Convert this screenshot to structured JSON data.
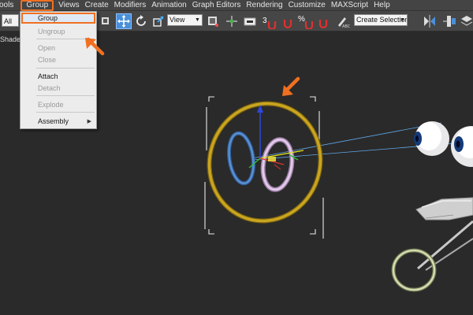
{
  "menu": {
    "items": [
      "ools",
      "Group",
      "Views",
      "Create",
      "Modifiers",
      "Animation",
      "Graph Editors",
      "Rendering",
      "Customize",
      "MAXScript",
      "Help"
    ]
  },
  "toolbar": {
    "selection_filter": "All",
    "reference_coord": "View",
    "snap_label": "3",
    "percent_label": "%",
    "named_selection_placeholder": "Create Selection Se"
  },
  "viewport": {
    "label": "Shaded"
  },
  "group_menu": {
    "items": [
      {
        "label": "Group",
        "enabled": true,
        "highlighted": true
      },
      {
        "label": "Ungroup",
        "enabled": false
      },
      {
        "label": "Open",
        "enabled": false
      },
      {
        "label": "Close",
        "enabled": false
      },
      {
        "label": "Attach",
        "enabled": true
      },
      {
        "label": "Detach",
        "enabled": false
      },
      {
        "label": "Explode",
        "enabled": false
      },
      {
        "label": "Assembly",
        "enabled": true,
        "submenu": true
      }
    ]
  },
  "colors": {
    "highlight": "#f07020",
    "gold_ring": "#c9a520",
    "blue_ring": "#5a8fd0",
    "pink_ring": "#d8b8e0"
  }
}
